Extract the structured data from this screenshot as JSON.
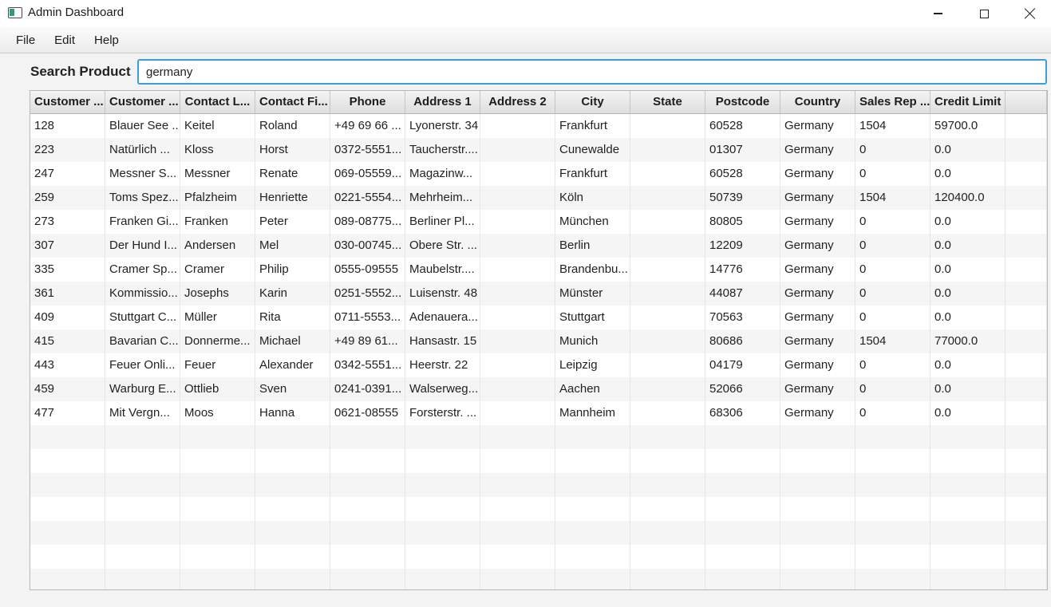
{
  "window": {
    "title": "Admin Dashboard",
    "icon": "app-window-icon",
    "controls": [
      "minimize-icon",
      "maximize-icon",
      "close-icon"
    ]
  },
  "menu": {
    "items": [
      {
        "label": "File"
      },
      {
        "label": "Edit"
      },
      {
        "label": "Help"
      }
    ]
  },
  "search": {
    "label": "Search Product",
    "value": "germany"
  },
  "table": {
    "columns": [
      "Customer ...",
      "Customer ...",
      "Contact L...",
      "Contact Fi...",
      "Phone",
      "Address 1",
      "Address 2",
      "City",
      "State",
      "Postcode",
      "Country",
      "Sales Rep ...",
      "Credit Limit"
    ],
    "rows": [
      [
        "128",
        "Blauer See ...",
        "Keitel",
        "Roland",
        "+49 69 66 ...",
        "Lyonerstr. 34",
        "",
        "Frankfurt",
        "",
        "60528",
        "Germany",
        "1504",
        "59700.0"
      ],
      [
        "223",
        "Natürlich ...",
        "Kloss",
        "Horst",
        "0372-5551...",
        "Taucherstr....",
        "",
        "Cunewalde",
        "",
        "01307",
        "Germany",
        "0",
        "0.0"
      ],
      [
        "247",
        "Messner S...",
        "Messner",
        "Renate",
        "069-05559...",
        "Magazinw...",
        "",
        "Frankfurt",
        "",
        "60528",
        "Germany",
        "0",
        "0.0"
      ],
      [
        "259",
        "Toms Spez...",
        "Pfalzheim",
        "Henriette",
        "0221-5554...",
        "Mehrheim...",
        "",
        "Köln",
        "",
        "50739",
        "Germany",
        "1504",
        "120400.0"
      ],
      [
        "273",
        "Franken Gi...",
        "Franken",
        "Peter",
        "089-08775...",
        "Berliner Pl...",
        "",
        "München",
        "",
        "80805",
        "Germany",
        "0",
        "0.0"
      ],
      [
        "307",
        "Der Hund I...",
        "Andersen",
        "Mel",
        "030-00745...",
        "Obere Str. ...",
        "",
        "Berlin",
        "",
        "12209",
        "Germany",
        "0",
        "0.0"
      ],
      [
        "335",
        "Cramer Sp...",
        "Cramer",
        "Philip",
        "0555-09555",
        "Maubelstr....",
        "",
        "Brandenbu...",
        "",
        "14776",
        "Germany",
        "0",
        "0.0"
      ],
      [
        "361",
        "Kommissio...",
        "Josephs",
        "Karin",
        "0251-5552...",
        "Luisenstr. 48",
        "",
        "Münster",
        "",
        "44087",
        "Germany",
        "0",
        "0.0"
      ],
      [
        "409",
        "Stuttgart C...",
        "Müller",
        "Rita",
        "0711-5553...",
        "Adenauera...",
        "",
        "Stuttgart",
        "",
        "70563",
        "Germany",
        "0",
        "0.0"
      ],
      [
        "415",
        "Bavarian C...",
        "Donnerme...",
        "Michael",
        "+49 89 61...",
        "Hansastr. 15",
        "",
        "Munich",
        "",
        "80686",
        "Germany",
        "1504",
        "77000.0"
      ],
      [
        "443",
        "Feuer Onli...",
        "Feuer",
        "Alexander",
        "0342-5551...",
        "Heerstr. 22",
        "",
        "Leipzig",
        "",
        "04179",
        "Germany",
        "0",
        "0.0"
      ],
      [
        "459",
        "Warburg E...",
        "Ottlieb",
        "Sven",
        "0241-0391...",
        "Walserweg...",
        "",
        "Aachen",
        "",
        "52066",
        "Germany",
        "0",
        "0.0"
      ],
      [
        "477",
        "Mit Vergn...",
        "Moos",
        "Hanna",
        "0621-08555",
        "Forsterstr. ...",
        "",
        "Mannheim",
        "",
        "68306",
        "Germany",
        "0",
        "0.0"
      ]
    ]
  }
}
